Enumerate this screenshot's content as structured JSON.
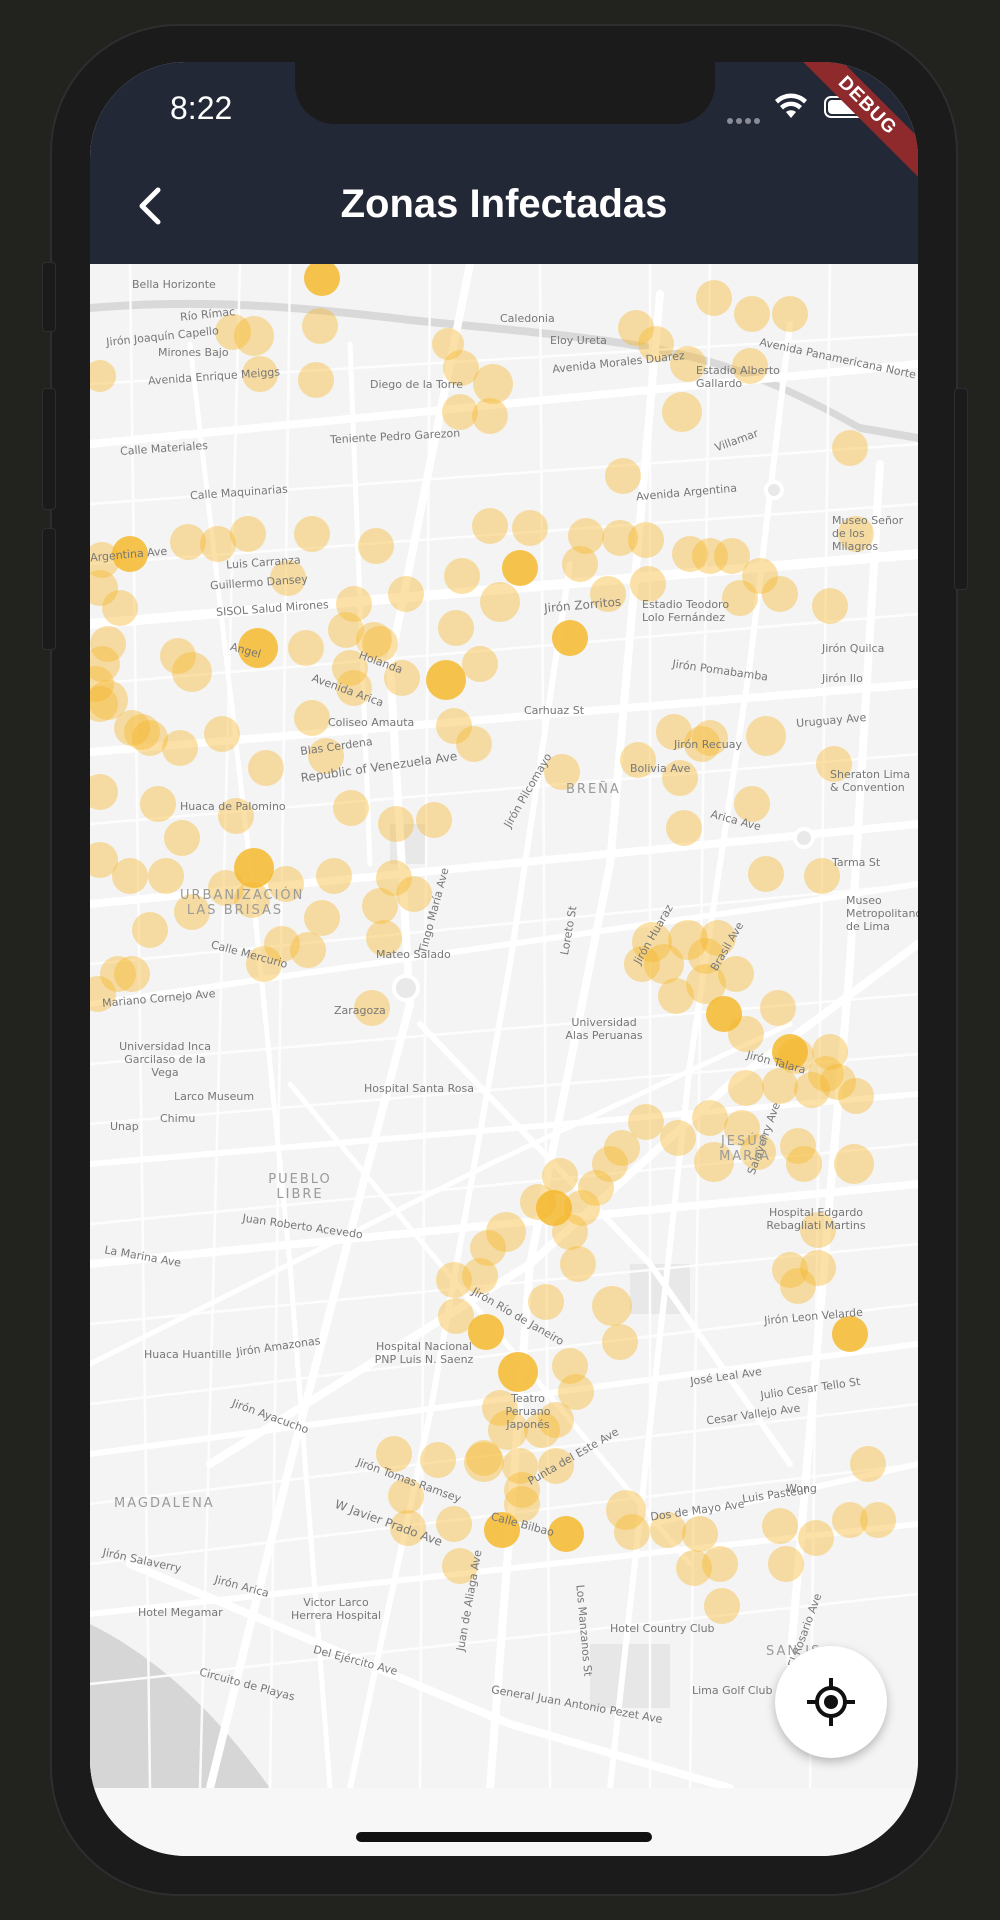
{
  "status_bar": {
    "time": "8:22",
    "debug_banner": "DEBUG"
  },
  "app_bar": {
    "title": "Zonas Infectadas",
    "back_icon": "chevron-left-icon"
  },
  "fab": {
    "icon": "my-location-icon"
  },
  "colors": {
    "app_bar": "#232837",
    "marker": "#f5b82e",
    "debug": "#8e2a2c"
  },
  "map": {
    "districts": [
      "BREÑA",
      "URBANIZACIÓN LAS BRISAS",
      "PUEBLO LIBRE",
      "JESÚS MARÍA",
      "MAGDALENA",
      "SAN IS"
    ],
    "labels": [
      "Bella Horizonte",
      "Río Rímac",
      "Jirón Joaquín Capello",
      "Mirones Bajo",
      "Avenida Enrique Meiggs",
      "Diego de la Torre",
      "Caledonia",
      "Eloy Ureta",
      "Avenida Morales Duarez",
      "Avenida Panamericana Norte",
      "Estadio Alberto Gallardo",
      "Calle Materiales",
      "Teniente Pedro Garezon",
      "Calle Maquinarias",
      "Villamar",
      "Avenida Argentina",
      "Argentina Ave",
      "Luis Carranza",
      "Guillermo Dansey",
      "SISOL Salud Mirones",
      "Jirón Zorritos",
      "Estadio Teodoro Lolo Fernández",
      "Museo Señor de los Milagros",
      "Angel",
      "Holanda",
      "Avenida Arica",
      "Coliseo Amauta",
      "Carhuaz St",
      "Jirón Pomabamba",
      "Uruguay Ave",
      "Jirón Quilca",
      "Jirón Ilo",
      "Blas Cerdena",
      "Republic of Venezuela Ave",
      "Jirón Recuay",
      "Bolivia Ave",
      "Sheraton Lima & Convention",
      "Huaca de Palomino",
      "Jirón Pilcomayo",
      "Arica Ave",
      "Tarma St",
      "Museo Metropolitano de Lima",
      "Tingo María Ave",
      "Calle Mercurio",
      "Mateo Salado",
      "Loreto St",
      "Jirón Huaraz",
      "Brasil Ave",
      "Mariano Cornejo Ave",
      "Zaragoza",
      "Universidad Alas Peruanas",
      "Jirón Talara",
      "Universidad Inca Garcilaso de la Vega",
      "Hospital Santa Rosa",
      "Larco Museum",
      "Chimu",
      "Unap",
      "Juan Roberto Acevedo",
      "La Marina Ave",
      "Hospital Edgardo Rebagliati Martins",
      "Jirón Río de Janeiro",
      "Hospital Nacional PNP Luis N. Saenz",
      "Jirón Leon Velarde",
      "Huaca Huantille",
      "Jirón Amazonas",
      "José Leal Ave",
      "Julio Cesar Tello St",
      "Teatro Peruano Japonés",
      "Cesar Vallejo Ave",
      "Jirón Ayacucho",
      "Punta del Este Ave",
      "Jirón Tomas Ramsey",
      "W Javier Prado Ave",
      "Calle Bilbao",
      "Dos de Mayo Ave",
      "Luis Pasteur",
      "Wong",
      "Jirón Salaverry",
      "Jirón Arica",
      "Hotel Megamar",
      "Victor Larco Herrera Hospital",
      "Hotel Country Club",
      "Los Manzanos St",
      "Del Ejército Ave",
      "Circuito de Playas",
      "Lima Golf Club",
      "General Juan Antonio Pezet Ave",
      "El Rosario Ave",
      "Salaverry Ave",
      "Juan de Aliaga Ave"
    ]
  }
}
